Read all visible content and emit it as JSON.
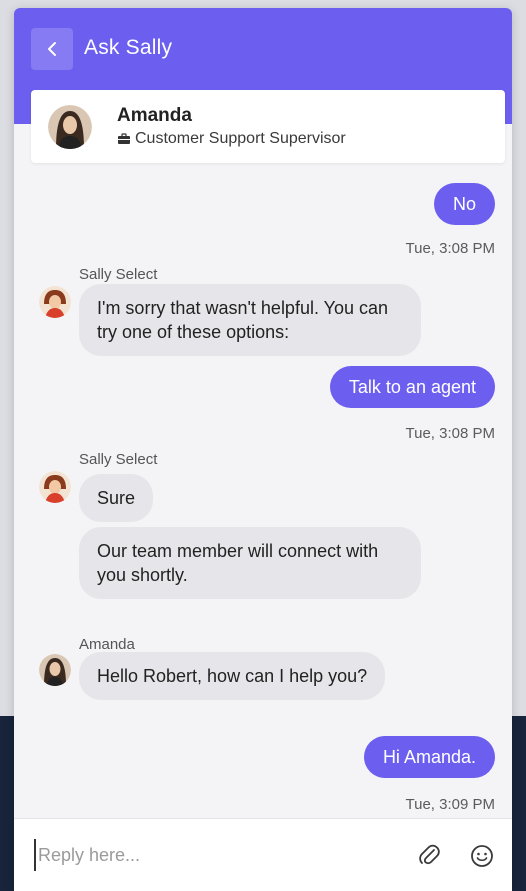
{
  "header": {
    "title": "Ask Sally"
  },
  "agent": {
    "name": "Amanda",
    "role": "Customer Support Supervisor"
  },
  "messages": [
    {
      "type": "user",
      "text": "No",
      "time": "Tue, 3:08 PM"
    },
    {
      "type": "bot",
      "sender": "Sally Select",
      "bubbles": [
        "I'm sorry that wasn't helpful. You can try one of these options:"
      ]
    },
    {
      "type": "user",
      "text": "Talk to an agent",
      "time": "Tue, 3:08 PM"
    },
    {
      "type": "bot",
      "sender": "Sally Select",
      "bubbles": [
        "Sure",
        "Our team member will connect with you shortly."
      ]
    },
    {
      "type": "agent",
      "sender": "Amanda",
      "bubbles": [
        "Hello Robert, how can I help you?"
      ]
    },
    {
      "type": "user",
      "text": "Hi Amanda.",
      "time": "Tue, 3:09 PM"
    }
  ],
  "reply": {
    "placeholder": "Reply here..."
  },
  "colors": {
    "accent": "#6c5ff0",
    "bubble_bot": "#e6e6ea"
  }
}
